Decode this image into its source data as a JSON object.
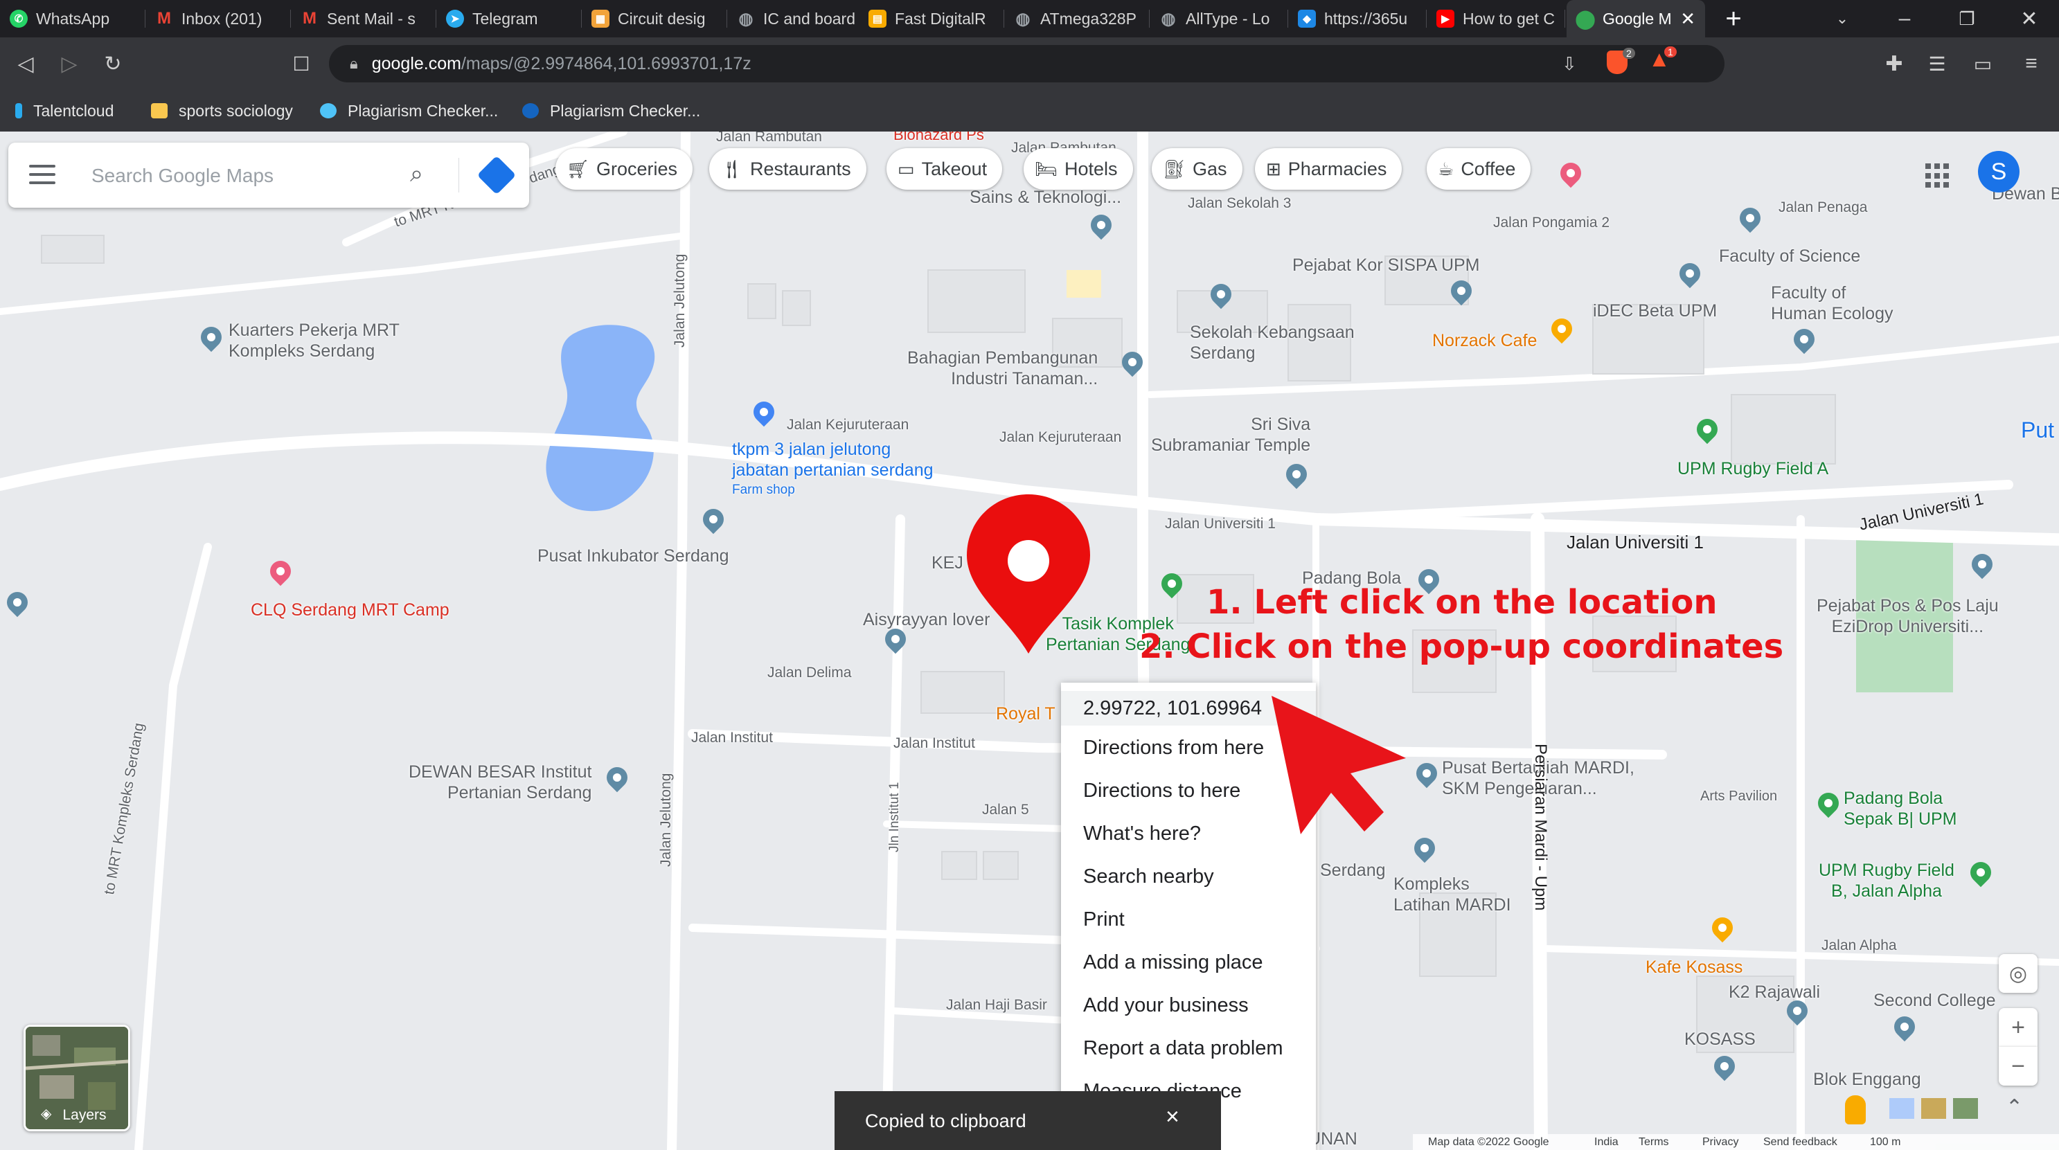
{
  "browser": {
    "tabs": [
      {
        "label": "WhatsApp",
        "icon": "whatsapp-icon",
        "color": "#25d366"
      },
      {
        "label": "Inbox (201)",
        "icon": "gmail-icon",
        "color": "#ea4335"
      },
      {
        "label": "Sent Mail - s",
        "icon": "gmail-icon",
        "color": "#ea4335"
      },
      {
        "label": "Telegram",
        "icon": "telegram-icon",
        "color": "#2aabee"
      },
      {
        "label": "Circuit desig",
        "icon": "circuit-icon",
        "color": "#f2a33a"
      },
      {
        "label": "IC and board",
        "icon": "globe-icon",
        "color": "#9aa0a6"
      },
      {
        "label": "Fast DigitalR",
        "icon": "digital-icon",
        "color": "#f9ab00"
      },
      {
        "label": "ATmega328P",
        "icon": "globe-icon",
        "color": "#9aa0a6"
      },
      {
        "label": "AllType - Lo",
        "icon": "globe-icon",
        "color": "#9aa0a6"
      },
      {
        "label": "https://365u",
        "icon": "link-icon",
        "color": "#1e88e5"
      },
      {
        "label": "How to get C",
        "icon": "youtube-icon",
        "color": "#ff0000"
      },
      {
        "label": "Google M",
        "icon": "maps-icon",
        "color": "#34a853"
      }
    ],
    "new_tab": "+",
    "url_host": "google.com",
    "url_path": "/maps/@2.9974864,101.6993701,17z",
    "bookmarks": [
      {
        "label": "Talentcloud",
        "color": "#2aabee"
      },
      {
        "label": "sports sociology",
        "color": "#f9c74f"
      },
      {
        "label": "Plagiarism Checker...",
        "color": "#4fc3f7"
      },
      {
        "label": "Plagiarism Checker...",
        "color": "#1565c0"
      }
    ],
    "shield_badge": "2",
    "alert_badge": "1"
  },
  "maps": {
    "search_placeholder": "Search Google Maps",
    "chips": [
      {
        "label": "Groceries",
        "icon": "cart-icon"
      },
      {
        "label": "Restaurants",
        "icon": "fork-knife-icon"
      },
      {
        "label": "Takeout",
        "icon": "takeout-icon"
      },
      {
        "label": "Hotels",
        "icon": "bed-icon"
      },
      {
        "label": "Gas",
        "icon": "gas-pump-icon"
      },
      {
        "label": "Pharmacies",
        "icon": "pharmacy-icon"
      },
      {
        "label": "Coffee",
        "icon": "coffee-icon"
      }
    ],
    "avatar_letter": "S",
    "context_menu": [
      "2.99722, 101.69964",
      "Directions from here",
      "Directions to here",
      "What's here?",
      "Search nearby",
      "Print",
      "Add a missing place",
      "Add your business",
      "Report a data problem",
      "Measure distance"
    ],
    "toast": {
      "text": "Copied to clipboard",
      "close": "×"
    },
    "layers_label": "Layers",
    "attribution": [
      "Map data ©2022 Google",
      "India",
      "Terms",
      "Privacy",
      "Send feedback",
      "100 m"
    ],
    "annotations": [
      "1. Left click on the location",
      "2. Click on the pop-up coordinates"
    ],
    "places": {
      "kuarters": "Kuarters Pekerja MRT\nKompleks Serdang",
      "tkpm": "tkpm 3 jalan jelutong\njabatan pertanian serdang",
      "farm_shop": "Farm shop",
      "bahagian": "Bahagian Pembangunan\nIndustri Tanaman...",
      "sekolah": "Sekolah Kebangsaan\nSerdang",
      "pejabat_kor": "Pejabat Kor SISPA UPM",
      "norzack": "Norzack Cafe",
      "idec": "iDEC Beta UPM",
      "faculty_science": "Faculty of Science",
      "faculty_ecology": "Faculty of\nHuman Ecology",
      "upm_rugby_a": "UPM Rugby Field A",
      "sri_siva": "Sri Siva\nSubramaniar Temple",
      "pusat_inkubator": "Pusat Inkubator Serdang",
      "clq": "CLQ Serdang MRT Camp",
      "aisyrayyan": "Aisyrayyan lover",
      "tasik": "Tasik Komplek\nPertanian Serdang",
      "padang_bola": "Padang Bola",
      "pejabat_pos": "Pejabat Pos & Pos Laju\nEziDrop Universiti...",
      "royal": "Royal T",
      "dewan_besar": "DEWAN BESAR Institut\nPertanian Serdang",
      "pusat_bertauliah": "Pusat Bertauliah MARDI,\nSKM Pengeluaran...",
      "arts_pavilion": "Arts Pavilion",
      "padang_bola_b": "Padang Bola\nSepak B| UPM",
      "upm_rugby_b": "UPM Rugby Field\nB, Jalan Alpha",
      "kompleks_latihan": "Kompleks\nLatihan MARDI",
      "serdang": "Serdang",
      "kafe_kosass": "Kafe Kosass",
      "k2": "K2 Rajawali",
      "second_college": "Second College",
      "kosass": "KOSASS",
      "blok_enggang": "Blok Enggang",
      "pembangunan": "PEMBANGUNAN",
      "dewan_b": "Dewan B",
      "put": "Put",
      "sains": "Sains & Teknologi...",
      "bionazard": "Bionazard Ps",
      "kej": "KEJ"
    },
    "roads": {
      "rambutan": "Jalan Rambutan",
      "pambutan": "Jalan Pambutan",
      "sekolah3": "Jalan Sekolah 3",
      "pongamia": "Jalan Pongamia 2",
      "penaga": "Jalan Penaga",
      "mrt_kompleks": "to MRT Kompleks Serdang",
      "kejuruteraan1": "Jalan Kejuruteraan",
      "kejuruteraan2": "Jalan Kejuruteraan",
      "universiti1": "Jalan Universiti 1",
      "universiti1b": "Jalan Universiti 1",
      "universiti1c": "Jalan Universiti 1",
      "delima": "Jalan Delima",
      "institut": "Jalan Institut",
      "institut2": "Jalan Institut",
      "jalan5": "Jalan 5",
      "haji_basir": "Jalan Haji Basir",
      "alpha": "Jalan Alpha",
      "jelutong": "Jalan Jelutong",
      "jelutong2": "Jalan Jelutong",
      "persiaran_mardi": "Persiaran Mardi - Upm",
      "to_mrt_kompleks_v": "to MRT Kompleks Serdang",
      "jln_institut1": "Jln Institut 1"
    }
  }
}
